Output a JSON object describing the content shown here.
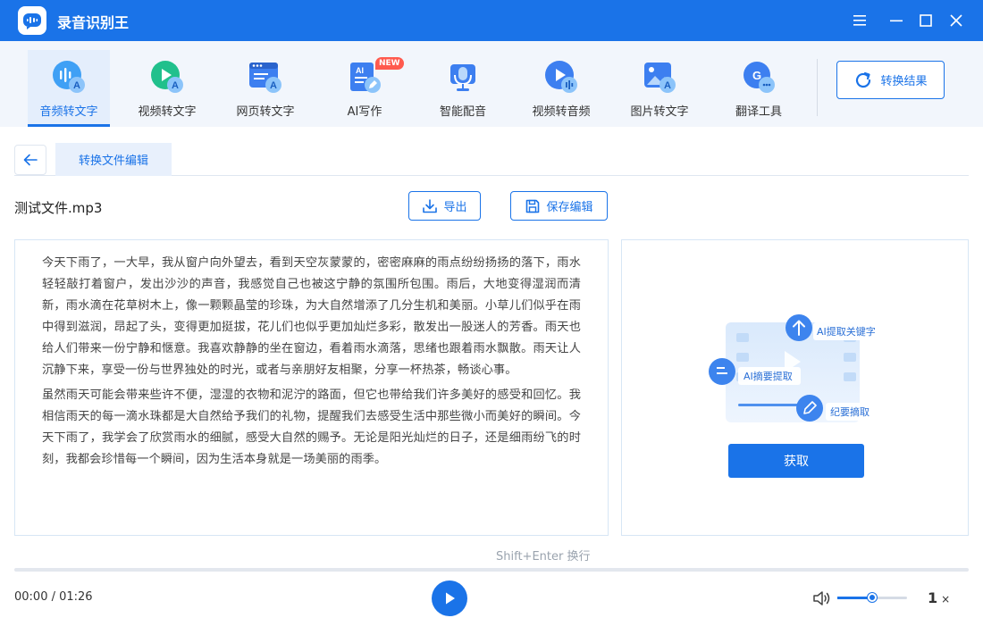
{
  "app": {
    "title": "录音识别王"
  },
  "toolbar": {
    "tools": [
      {
        "label": "音频转文字",
        "icon": "audio-to-text-icon",
        "active": true
      },
      {
        "label": "视频转文字",
        "icon": "video-to-text-icon"
      },
      {
        "label": "网页转文字",
        "icon": "webpage-to-text-icon"
      },
      {
        "label": "AI写作",
        "icon": "ai-writing-icon",
        "badge": "NEW"
      },
      {
        "label": "智能配音",
        "icon": "smart-dubbing-icon"
      },
      {
        "label": "视频转音频",
        "icon": "video-to-audio-icon"
      },
      {
        "label": "图片转文字",
        "icon": "image-to-text-icon"
      },
      {
        "label": "翻译工具",
        "icon": "translate-icon"
      }
    ],
    "result_button": "转换结果"
  },
  "tabs": {
    "active": "转换文件编辑"
  },
  "file": {
    "name": "测试文件.mp3",
    "export_label": "导出",
    "save_label": "保存编辑"
  },
  "transcript": {
    "paragraphs": [
      "今天下雨了，一大早，我从窗户向外望去，看到天空灰蒙蒙的，密密麻麻的雨点纷纷扬扬的落下，雨水轻轻敲打着窗户，发出沙沙的声音，我感觉自己也被这宁静的氛围所包围。雨后，大地变得湿润而清新，雨水滴在花草树木上，像一颗颗晶莹的珍珠，为大自然增添了几分生机和美丽。小草儿们似乎在雨中得到滋润，昂起了头，变得更加挺拔，花儿们也似乎更加灿烂多彩，散发出一股迷人的芳香。雨天也给人们带来一份宁静和惬意。我喜欢静静的坐在窗边，看着雨水滴落，思绪也跟着雨水飘散。雨天让人沉静下来，享受一份与世界独处的时光，或者与亲朋好友相聚，分享一杯热茶，畅谈心事。",
      "虽然雨天可能会带来些许不便，湿湿的衣物和泥泞的路面，但它也带给我们许多美好的感受和回忆。我相信雨天的每一滴水珠都是大自然给予我们的礼物，提醒我们去感受生活中那些微小而美好的瞬间。今天下雨了，我学会了欣赏雨水的细腻，感受大自然的赐予。无论是阳光灿烂的日子，还是细雨纷飞的时刻，我都会珍惜每一个瞬间，因为生活本身就是一场美丽的雨季。"
    ],
    "hint": "Shift+Enter 换行"
  },
  "ai_panel": {
    "tag_keywords": "AI提取关键字",
    "tag_summary": "AI摘要提取",
    "tag_minutes": "纪要摘取",
    "get_button": "获取"
  },
  "player": {
    "time": "00:00 / 01:26",
    "progress": 0,
    "volume": 0.5,
    "speed": "1",
    "speed_unit": "×"
  },
  "colors": {
    "primary": "#1a73e8",
    "toolbar_bg": "#f2f6fc"
  }
}
